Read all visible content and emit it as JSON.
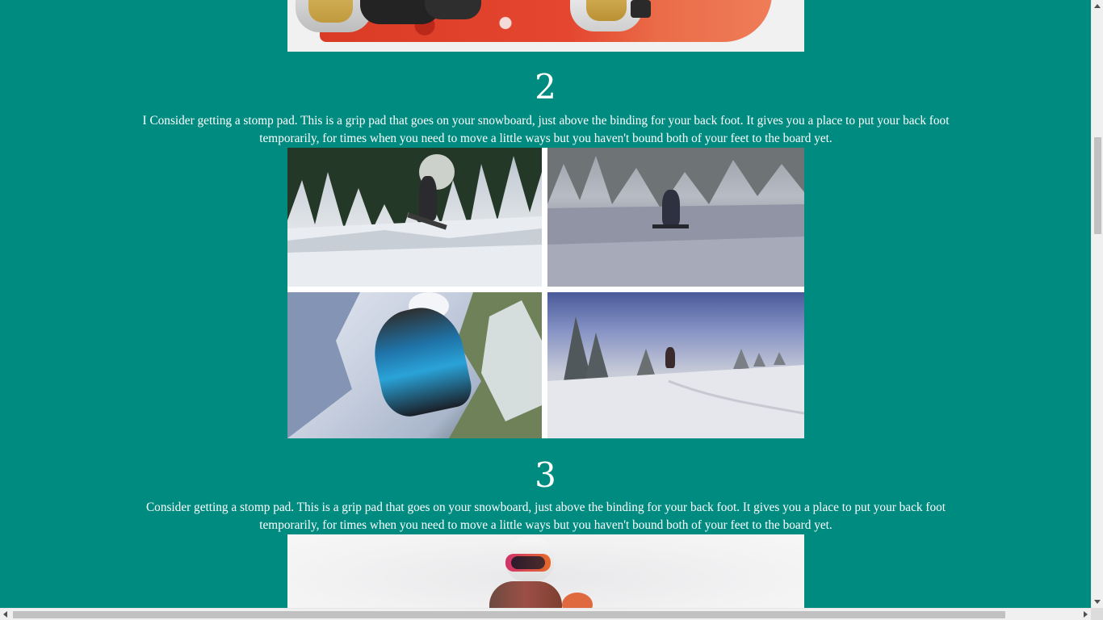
{
  "colors": {
    "page_background": "#008b80",
    "text": "#ffffff",
    "scrollbar_track": "#f0f0f0",
    "scrollbar_thumb": "#c1c1c1"
  },
  "images": {
    "top_photo": "snowboard-with-bindings-photo",
    "collage": "snowboarders-in-snow-collage",
    "bottom_photo": "snowboarder-with-helmet-and-goggles-photo"
  },
  "steps": [
    {
      "number": "2",
      "text": "I Consider getting a stomp pad. This is a grip pad that goes on your snowboard, just above the binding for your back foot. It gives you a place to put your back foot temporarily, for times when you need to move a little ways but you haven't bound both of your feet to the board yet."
    },
    {
      "number": "3",
      "text": "Consider getting a stomp pad. This is a grip pad that goes on your snowboard, just above the binding for your back foot. It gives you a place to put your back foot temporarily, for times when you need to move a little ways but you haven't bound both of your feet to the board yet."
    }
  ]
}
